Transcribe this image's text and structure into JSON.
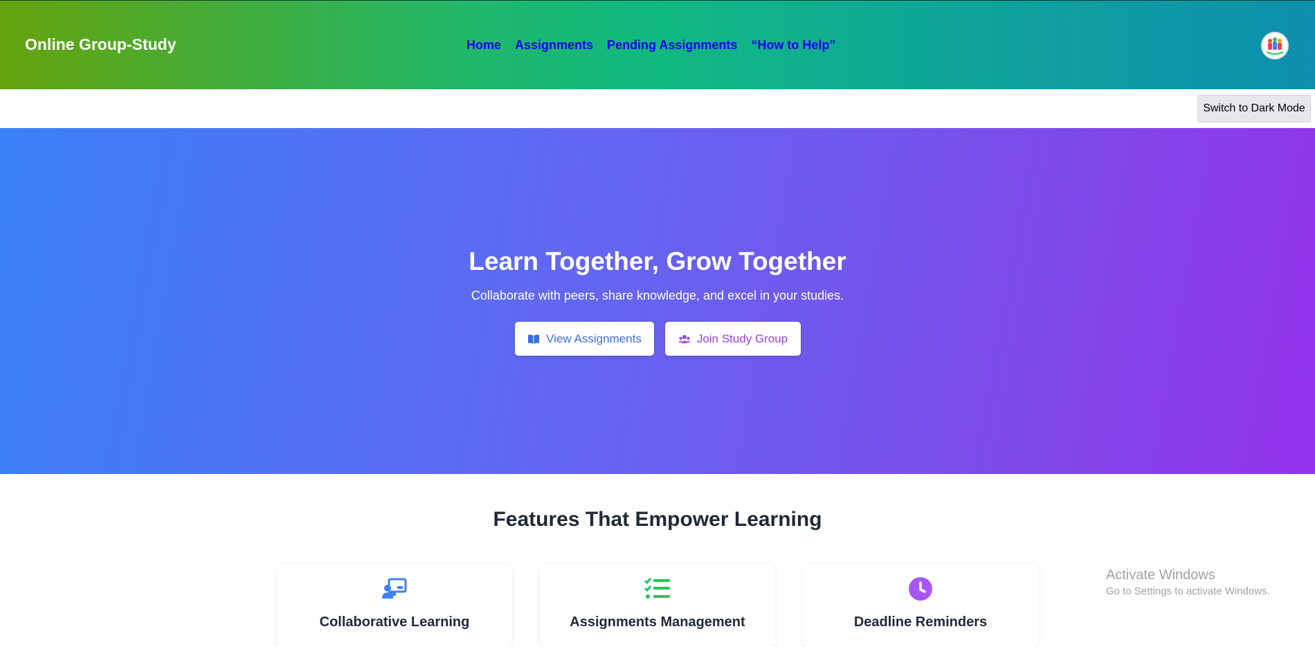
{
  "header": {
    "brand": "Online Group-Study",
    "nav": [
      {
        "label": "Home"
      },
      {
        "label": "Assignments"
      },
      {
        "label": "Pending Assignments"
      },
      {
        "label": "“How to Help”"
      }
    ],
    "logo_icon": "group-people-logo"
  },
  "theme_toggle": {
    "label": "Switch to Dark Mode"
  },
  "hero": {
    "title": "Learn Together, Grow Together",
    "subtitle": "Collaborate with peers, share knowledge, and excel in your studies.",
    "buttons": [
      {
        "label": "View Assignments",
        "icon": "book-open-icon",
        "color": "#3b6fe8"
      },
      {
        "label": "Join Study Group",
        "icon": "users-icon",
        "color": "#9b3fe6"
      }
    ]
  },
  "features": {
    "title": "Features That Empower Learning",
    "cards": [
      {
        "title": "Collaborative Learning",
        "icon": "chalkboard-teacher-icon",
        "color": "#3b82f6"
      },
      {
        "title": "Assignments Management",
        "icon": "list-check-icon",
        "color": "#22c55e"
      },
      {
        "title": "Deadline Reminders",
        "icon": "clock-icon",
        "color": "#a855f7"
      }
    ]
  },
  "watermark": {
    "title": "Activate Windows",
    "subtitle": "Go to Settings to activate Windows."
  }
}
